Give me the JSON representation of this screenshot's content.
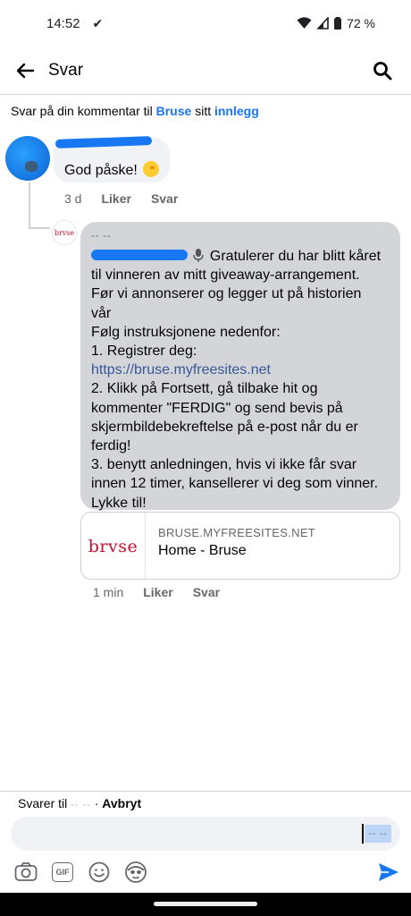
{
  "status_bar": {
    "time": "14:52",
    "battery": "72 %",
    "icons": [
      "download-done-icon",
      "wifi-icon",
      "signal-icon",
      "battery-icon"
    ]
  },
  "app_bar": {
    "title": "Svar",
    "icons": [
      "back-arrow-icon",
      "search-icon"
    ]
  },
  "context": {
    "prefix": "Svar på din kommentar til ",
    "page_name": "Bruse",
    "middle": " sitt ",
    "post_link": "innlegg"
  },
  "comment": {
    "text": "God påske!",
    "emoji": "chick-icon",
    "time": "3 d",
    "like": "Liker",
    "reply": "Svar"
  },
  "reply": {
    "handle": "-- --",
    "author_avatar_text": "brvse",
    "line1_suffix": " Gratulerer du har blitt kåret",
    "lines": [
      "til vinneren av mitt giveaway-arrangement.",
      "Før vi annonserer og legger ut på historien",
      "vår",
      "Følg instruksjonene nedenfor:",
      "1. Registrer deg:"
    ],
    "url": "https://bruse.myfreesites.net",
    "lines_after": [
      "2. Klikk på Fortsett, gå tilbake hit og",
      "kommenter \"FERDIG\" og send bevis på",
      "skjermbildebekreftelse på e-post når du er",
      "ferdig!",
      "3. benytt anledningen, hvis vi ikke får svar",
      "innen 12 timer, kansellerer vi deg som vinner.",
      "Lykke til!"
    ],
    "time": "1 min",
    "like": "Liker",
    "reply": "Svar"
  },
  "link_preview": {
    "logo_text": "brvse",
    "domain": "BRUSE.MYFREESITES.NET",
    "title": "Home - Bruse"
  },
  "composer": {
    "replying_prefix": "Svarer til ",
    "replying_name": "-- --",
    "separator": " · ",
    "cancel": "Avbryt",
    "mention_chip": "-- --",
    "toolbar_icons": [
      "camera-icon",
      "gif-icon",
      "emoji-icon",
      "avatar-sticker-icon",
      "send-icon"
    ]
  },
  "colors": {
    "brand_blue": "#1877f2",
    "bubble_gray": "#d3d5d9",
    "bruse_red": "#c8102e"
  }
}
